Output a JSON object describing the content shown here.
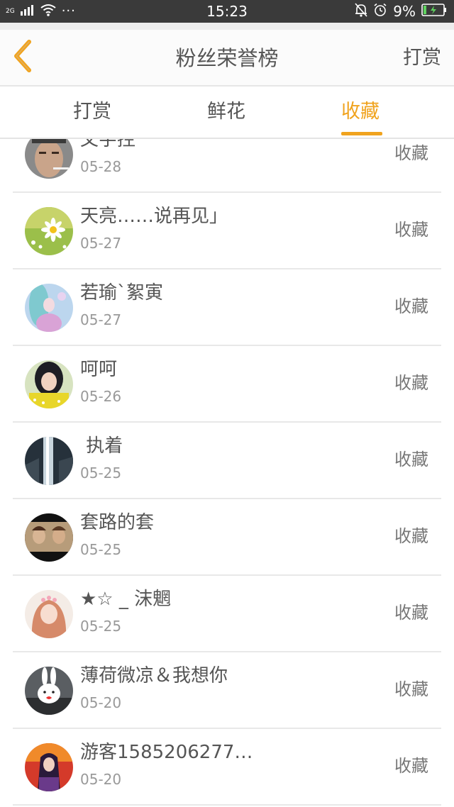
{
  "status_bar": {
    "network": "2G",
    "dots": "···",
    "time": "15:23",
    "battery_percent": "9%",
    "icons": [
      "signal-icon",
      "wifi-icon",
      "mute-bell-icon",
      "alarm-icon",
      "battery-charging-icon"
    ]
  },
  "header": {
    "title": "粉丝荣誉榜",
    "action_label": "打赏",
    "back_icon": "chevron-left-icon"
  },
  "tabs": [
    {
      "label": "打赏"
    },
    {
      "label": "鲜花"
    },
    {
      "label": "收藏"
    }
  ],
  "active_tab_index": 2,
  "list": [
    {
      "name": "文字控",
      "date": "05-28",
      "action": "收藏"
    },
    {
      "name": "天亮……说再见」",
      "date": "05-27",
      "action": "收藏"
    },
    {
      "name": "若瑜`絮寅",
      "date": "05-27",
      "action": "收藏"
    },
    {
      "name": "呵呵",
      "date": "05-26",
      "action": "收藏"
    },
    {
      "name": "执着",
      "date": "05-25",
      "action": "收藏"
    },
    {
      "name": "套路的套",
      "date": "05-25",
      "action": "收藏"
    },
    {
      "name": "★☆ _ 沫魍",
      "date": "05-25",
      "action": "收藏"
    },
    {
      "name": "薄荷微凉＆我想你",
      "date": "05-20",
      "action": "收藏"
    },
    {
      "name": "游客1585206277…",
      "date": "05-20",
      "action": "收藏"
    }
  ],
  "colors": {
    "accent": "#f0a31e",
    "status_bar": "#3a3a3a",
    "text": "#555555",
    "muted": "#999999"
  }
}
